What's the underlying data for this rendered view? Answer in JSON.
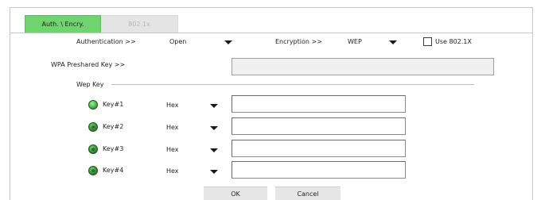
{
  "tabs": [
    {
      "label": "Auth. \\ Encry.",
      "active": true
    },
    {
      "label": "802.1x",
      "active": false
    }
  ],
  "auth": {
    "label": "Authentication >>",
    "value": "Open"
  },
  "encryption": {
    "label": "Encryption >>",
    "value": "WEP"
  },
  "use8021x": {
    "label": "Use 802.1X",
    "checked": false
  },
  "wpa": {
    "label": "WPA Preshared Key >>",
    "value": ""
  },
  "wep": {
    "group_label": "Wep Key",
    "keys": [
      {
        "label": "Key#1",
        "format": "Hex",
        "value": "",
        "selected": true
      },
      {
        "label": "Key#2",
        "format": "Hex",
        "value": "",
        "selected": false
      },
      {
        "label": "Key#3",
        "format": "Hex",
        "value": "",
        "selected": false
      },
      {
        "label": "Key#4",
        "format": "Hex",
        "value": "",
        "selected": false
      }
    ]
  },
  "buttons": {
    "ok": "OK",
    "cancel": "Cancel"
  },
  "colors": {
    "active_tab": "#6fd36f",
    "radio_green": "#2ea62e"
  }
}
